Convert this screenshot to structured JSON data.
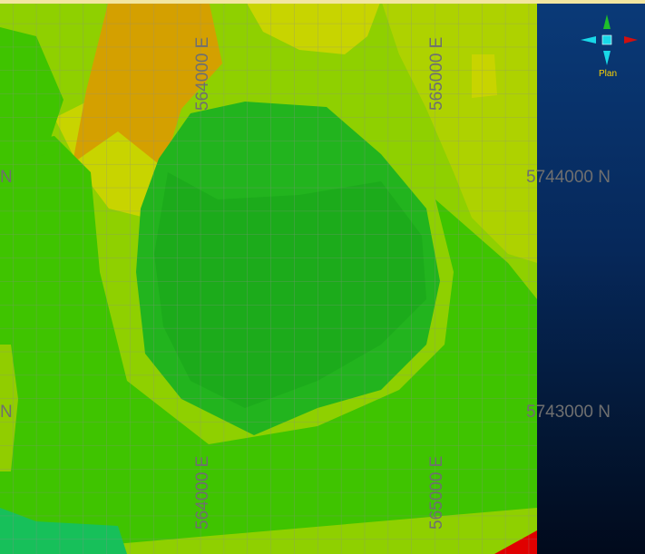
{
  "view": {
    "label": "Plan",
    "colors": {
      "background_top": "#0a3a78",
      "background_bottom": "#010a1c",
      "grid": "#8a8a8a",
      "label": "#6f6f6f",
      "label_accent": "#ffd400"
    }
  },
  "axes": {
    "easting_labels": [
      "564000 E",
      "565000 E"
    ],
    "northing_labels": [
      "5744000 N",
      "5743000 N"
    ],
    "left_edge_fragment": "N"
  },
  "legend_colors": {
    "high": "#d4a000",
    "upper": "#c8d400",
    "mid": "#8fd000",
    "lower": "#3fc400",
    "low": "#22b41e",
    "lowest": "#17c05a",
    "peak": "#e00000"
  },
  "icons": {
    "north": "arrow-green-up",
    "east": "arrow-red-right",
    "west": "arrow-cyan-left",
    "south": "arrow-cyan-down",
    "center": "cube-cyan"
  }
}
